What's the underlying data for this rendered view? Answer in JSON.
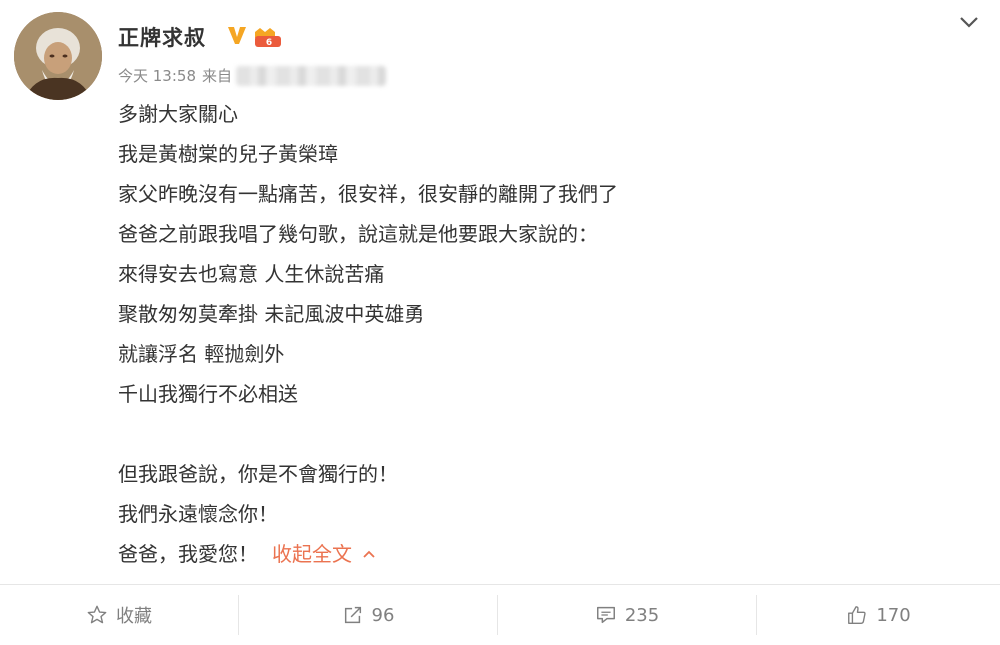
{
  "post": {
    "username": "正牌求叔",
    "time": "今天 13:58",
    "source_label": "来自",
    "lines": [
      "多謝大家關心",
      "我是黃樹棠的兒子黃榮璋",
      "家父昨晚沒有一點痛苦，很安祥，很安靜的離開了我們了",
      "爸爸之前跟我唱了幾句歌，說這就是他要跟大家說的：",
      "來得安去也寫意 人生休說苦痛",
      "聚散匆匆莫牽掛 未記風波中英雄勇",
      "就讓浮名 輕抛劍外",
      "千山我獨行不必相送",
      "",
      "但我跟爸說，你是不會獨行的！",
      "我們永遠懷念你！",
      "爸爸，我愛您！"
    ],
    "collapse_label": "收起全文"
  },
  "actions": {
    "favorite_label": "收藏",
    "repost_count": "96",
    "comment_count": "235",
    "like_count": "170"
  },
  "colors": {
    "accent": "#eb7350",
    "verified": "#f5a623",
    "text": "#333333",
    "muted": "#808080"
  },
  "icons": [
    "avatar",
    "verified-v-icon",
    "level-badge-icon",
    "chevron-down-icon",
    "star-icon",
    "repost-icon",
    "comment-icon",
    "thumbs-up-icon",
    "chevron-up-icon"
  ]
}
